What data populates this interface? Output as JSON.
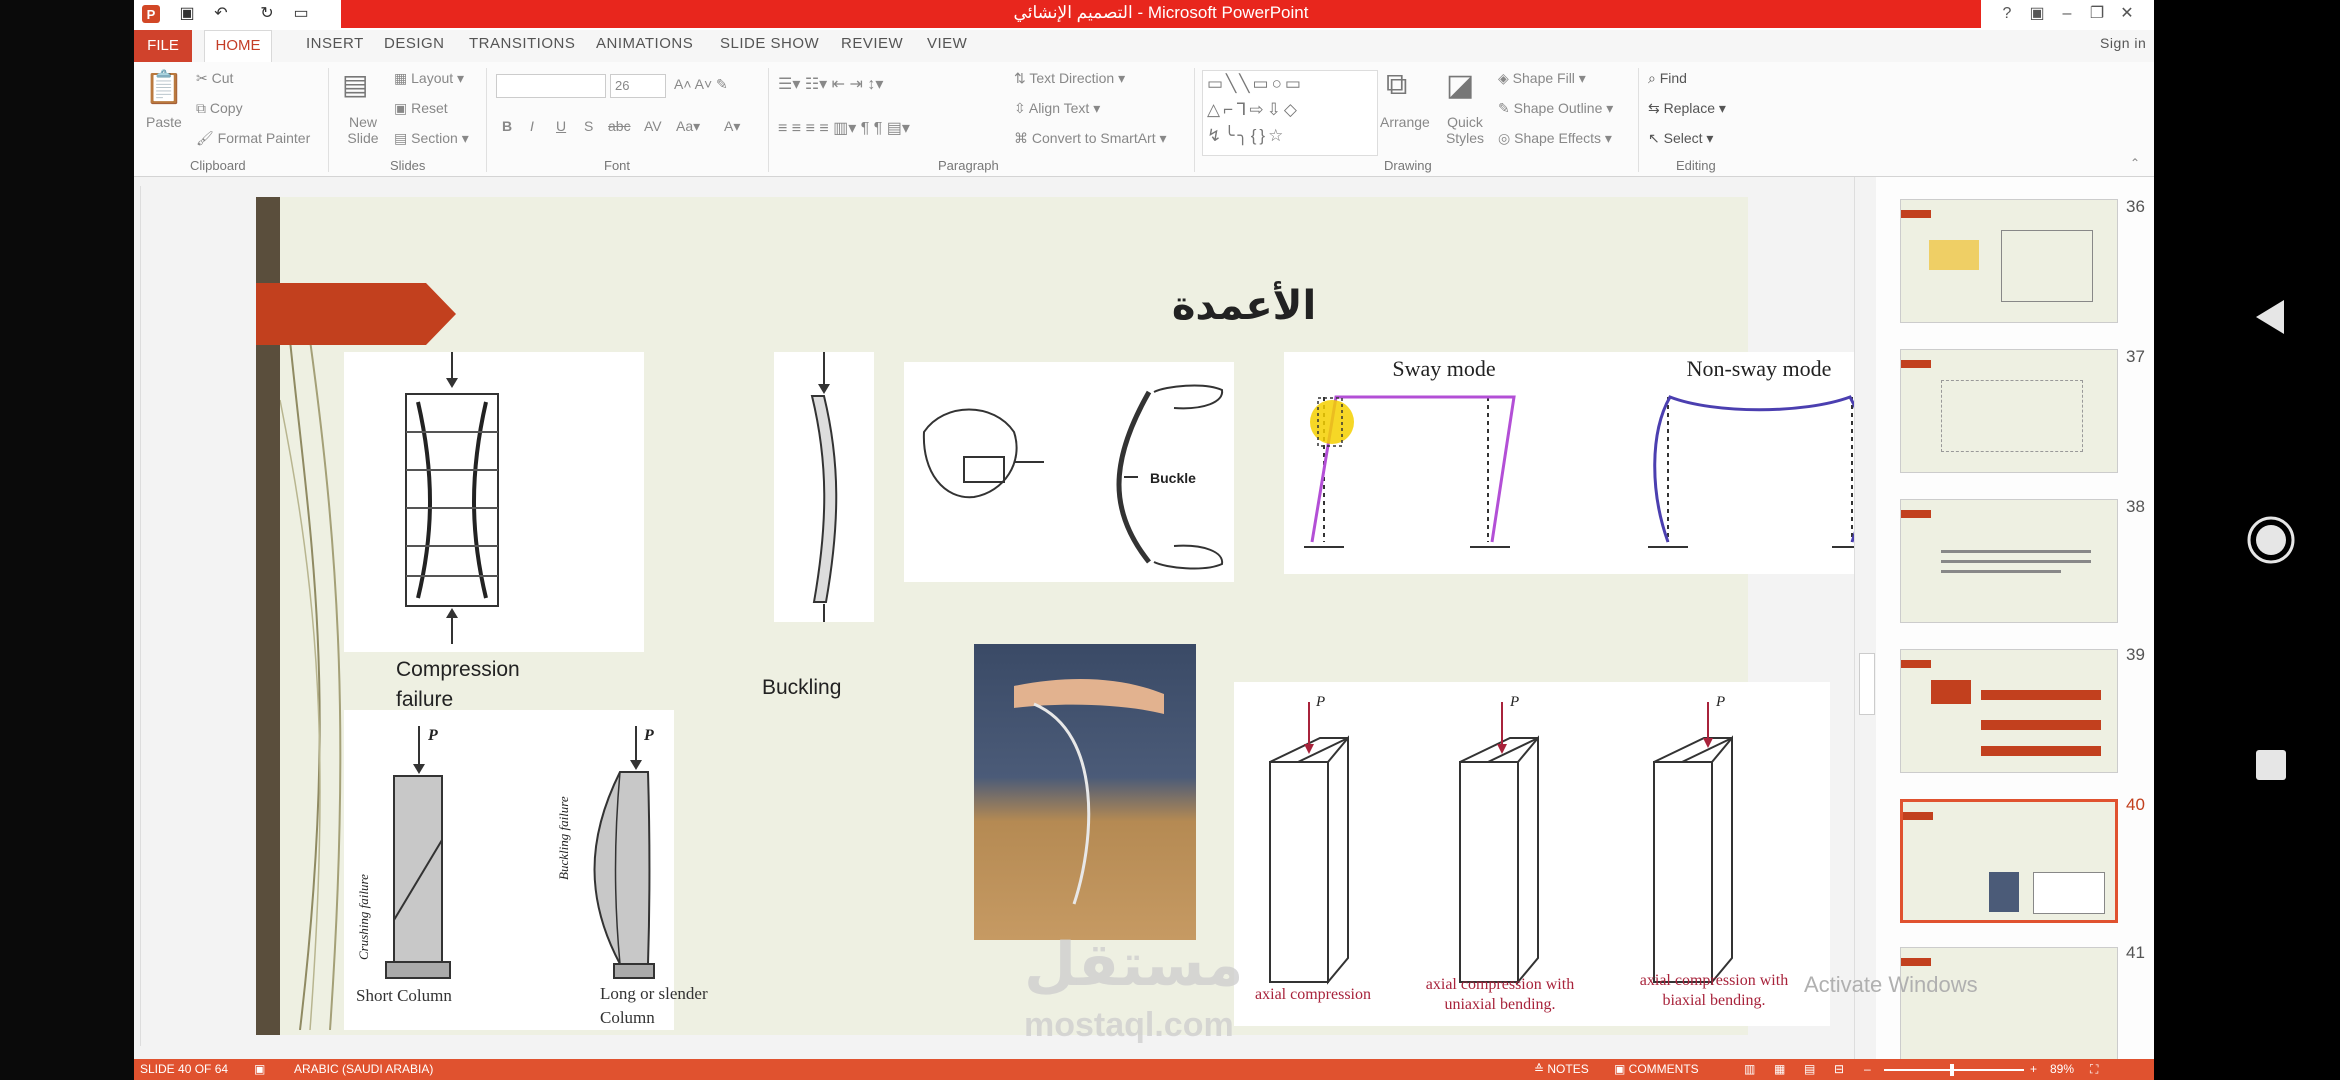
{
  "app": {
    "window_title": "التصميم الإنشائي - Microsoft PowerPoint",
    "sign_in": "Sign in"
  },
  "tabs": [
    "FILE",
    "HOME",
    "INSERT",
    "DESIGN",
    "TRANSITIONS",
    "ANIMATIONS",
    "SLIDE SHOW",
    "REVIEW",
    "VIEW"
  ],
  "ribbon": {
    "clipboard": {
      "paste": "Paste",
      "cut": "Cut",
      "copy": "Copy",
      "format_painter": "Format Painter",
      "group": "Clipboard"
    },
    "slides": {
      "new_slide": "New Slide",
      "layout": "Layout",
      "reset": "Reset",
      "section": "Section",
      "group": "Slides"
    },
    "font": {
      "size": "26",
      "group": "Font"
    },
    "paragraph": {
      "text_direction": "Text Direction",
      "align_text": "Align Text",
      "convert_smartart": "Convert to SmartArt",
      "group": "Paragraph"
    },
    "drawing": {
      "arrange": "Arrange",
      "quick_styles": "Quick Styles",
      "shape_fill": "Shape Fill",
      "shape_outline": "Shape Outline",
      "shape_effects": "Shape Effects",
      "group": "Drawing"
    },
    "editing": {
      "find": "Find",
      "replace": "Replace",
      "select": "Select",
      "group": "Editing"
    }
  },
  "slide": {
    "title": "الأعمدة",
    "sway_mode": "Sway mode",
    "non_sway_mode": "Non-sway mode",
    "buckle": "Buckle",
    "compression_failure_1": "Compression",
    "compression_failure_2": "failure",
    "buckling": "Buckling",
    "short_column": "Short Column",
    "long_column_1": "Long or slender",
    "long_column_2": "Column",
    "crushing_failure": "Crushing failure",
    "buckling_failure": "Buckling failure",
    "p_label": "P",
    "axial_compression": "axial compression",
    "uniaxial_1": "axial compression with",
    "uniaxial_2": "uniaxial bending.",
    "biaxial_1": "axial compression with",
    "biaxial_2": "biaxial bending."
  },
  "thumbnails": [
    {
      "number": "36",
      "selected": false
    },
    {
      "number": "37",
      "selected": false
    },
    {
      "number": "38",
      "selected": false
    },
    {
      "number": "39",
      "selected": false
    },
    {
      "number": "40",
      "selected": true
    },
    {
      "number": "41",
      "selected": false
    }
  ],
  "status": {
    "slide_info": "SLIDE 40 OF 64",
    "language": "ARABIC (SAUDI ARABIA)",
    "notes": "NOTES",
    "comments": "COMMENTS",
    "zoom": "89%"
  },
  "watermark": {
    "activate": "Activate Windows",
    "logo": "مستقل",
    "site": "mostaql.com"
  },
  "colors": {
    "accent_red": "#e8261d",
    "file_tab": "#d0422c",
    "status_bar": "#e0522f",
    "slide_bg": "#eef0e2",
    "sway_line": "#b34fd6",
    "nonsway_line": "#4b3fb0"
  }
}
